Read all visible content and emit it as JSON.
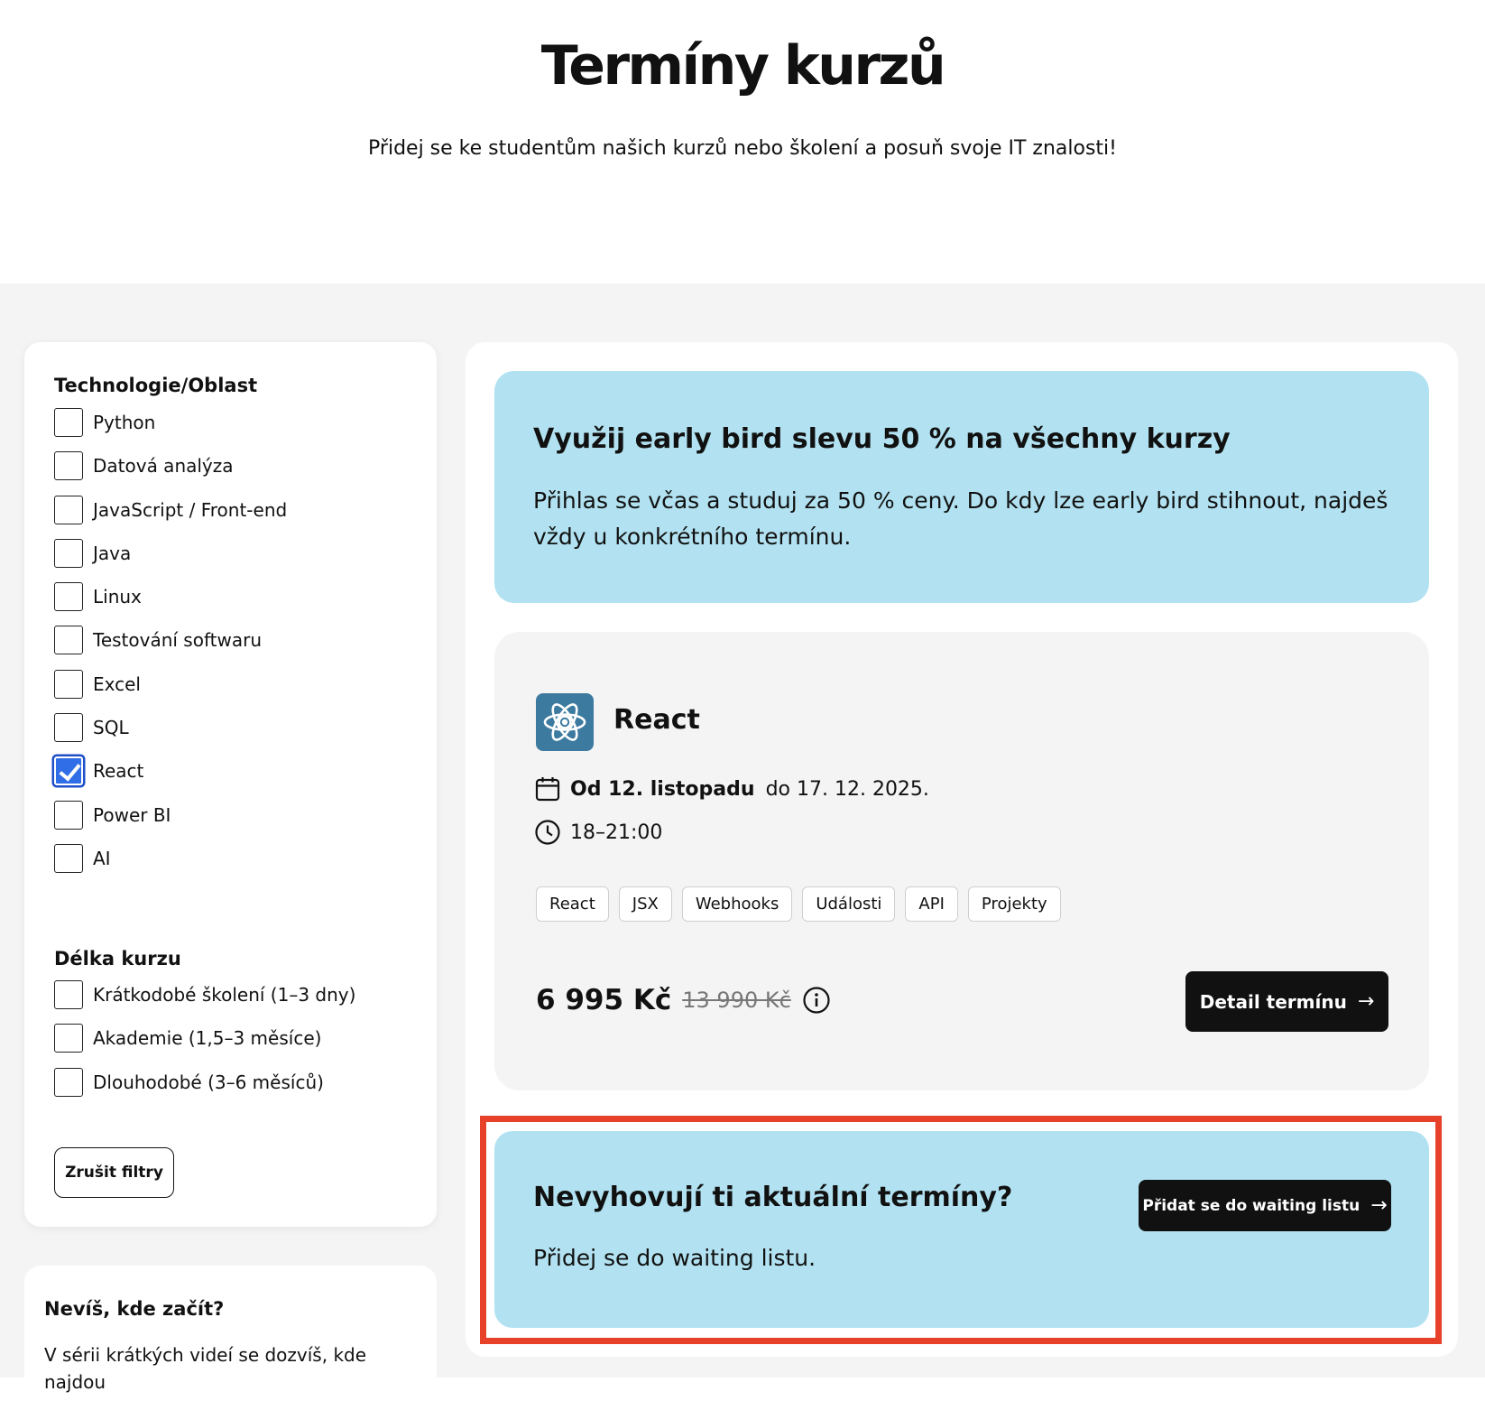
{
  "header": {
    "title": "Termíny kurzů",
    "subtitle": "Přidej se ke studentům našich kurzů nebo školení a posuň svoje IT znalosti!"
  },
  "filters": {
    "technology_title": "Technologie/Oblast",
    "technologies": [
      {
        "label": "Python",
        "checked": false
      },
      {
        "label": "Datová analýza",
        "checked": false
      },
      {
        "label": "JavaScript / Front-end",
        "checked": false
      },
      {
        "label": "Java",
        "checked": false
      },
      {
        "label": "Linux",
        "checked": false
      },
      {
        "label": "Testování softwaru",
        "checked": false
      },
      {
        "label": "Excel",
        "checked": false
      },
      {
        "label": "SQL",
        "checked": false
      },
      {
        "label": "React",
        "checked": true
      },
      {
        "label": "Power BI",
        "checked": false
      },
      {
        "label": "AI",
        "checked": false
      }
    ],
    "length_title": "Délka kurzu",
    "lengths": [
      {
        "label": "Krátkodobé školení (1–3 dny)",
        "checked": false
      },
      {
        "label": "Akademie (1,5–3 měsíce)",
        "checked": false
      },
      {
        "label": "Dlouhodobé (3–6 měsíců)",
        "checked": false
      }
    ],
    "clear_label": "Zrušit filtry"
  },
  "help": {
    "title": "Nevíš, kde začít?",
    "text": "V sérii krátkých videí se dozvíš, kde najdou"
  },
  "promo": {
    "title": "Využij early bird slevu 50 % na všechny kurzy",
    "text": "Přihlas se včas a studuj za 50 % ceny. Do kdy lze early bird stihnout, najdeš vždy u konkrétního termínu."
  },
  "course": {
    "name": "React",
    "logo_icon": "react-atom-icon",
    "date_from": "Od 12. listopadu",
    "date_to": "do 17. 12. 2025.",
    "time": "18–21:00",
    "tags": [
      "React",
      "JSX",
      "Webhooks",
      "Události",
      "API",
      "Projekty"
    ],
    "price": "6 995 Kč",
    "old_price": "13 990 Kč",
    "detail_label": "Detail termínu",
    "arrow": "→"
  },
  "waitlist": {
    "title": "Nevyhovují ti aktuální termíny?",
    "text": "Přidej se do waiting listu.",
    "button_label": "Přidat se do waiting listu",
    "arrow": "→",
    "highlight_color": "#e8412a"
  },
  "colors": {
    "accent_blue": "#b2e2f1",
    "checkbox_checked": "#2f6ee6",
    "button_dark": "#111111"
  }
}
